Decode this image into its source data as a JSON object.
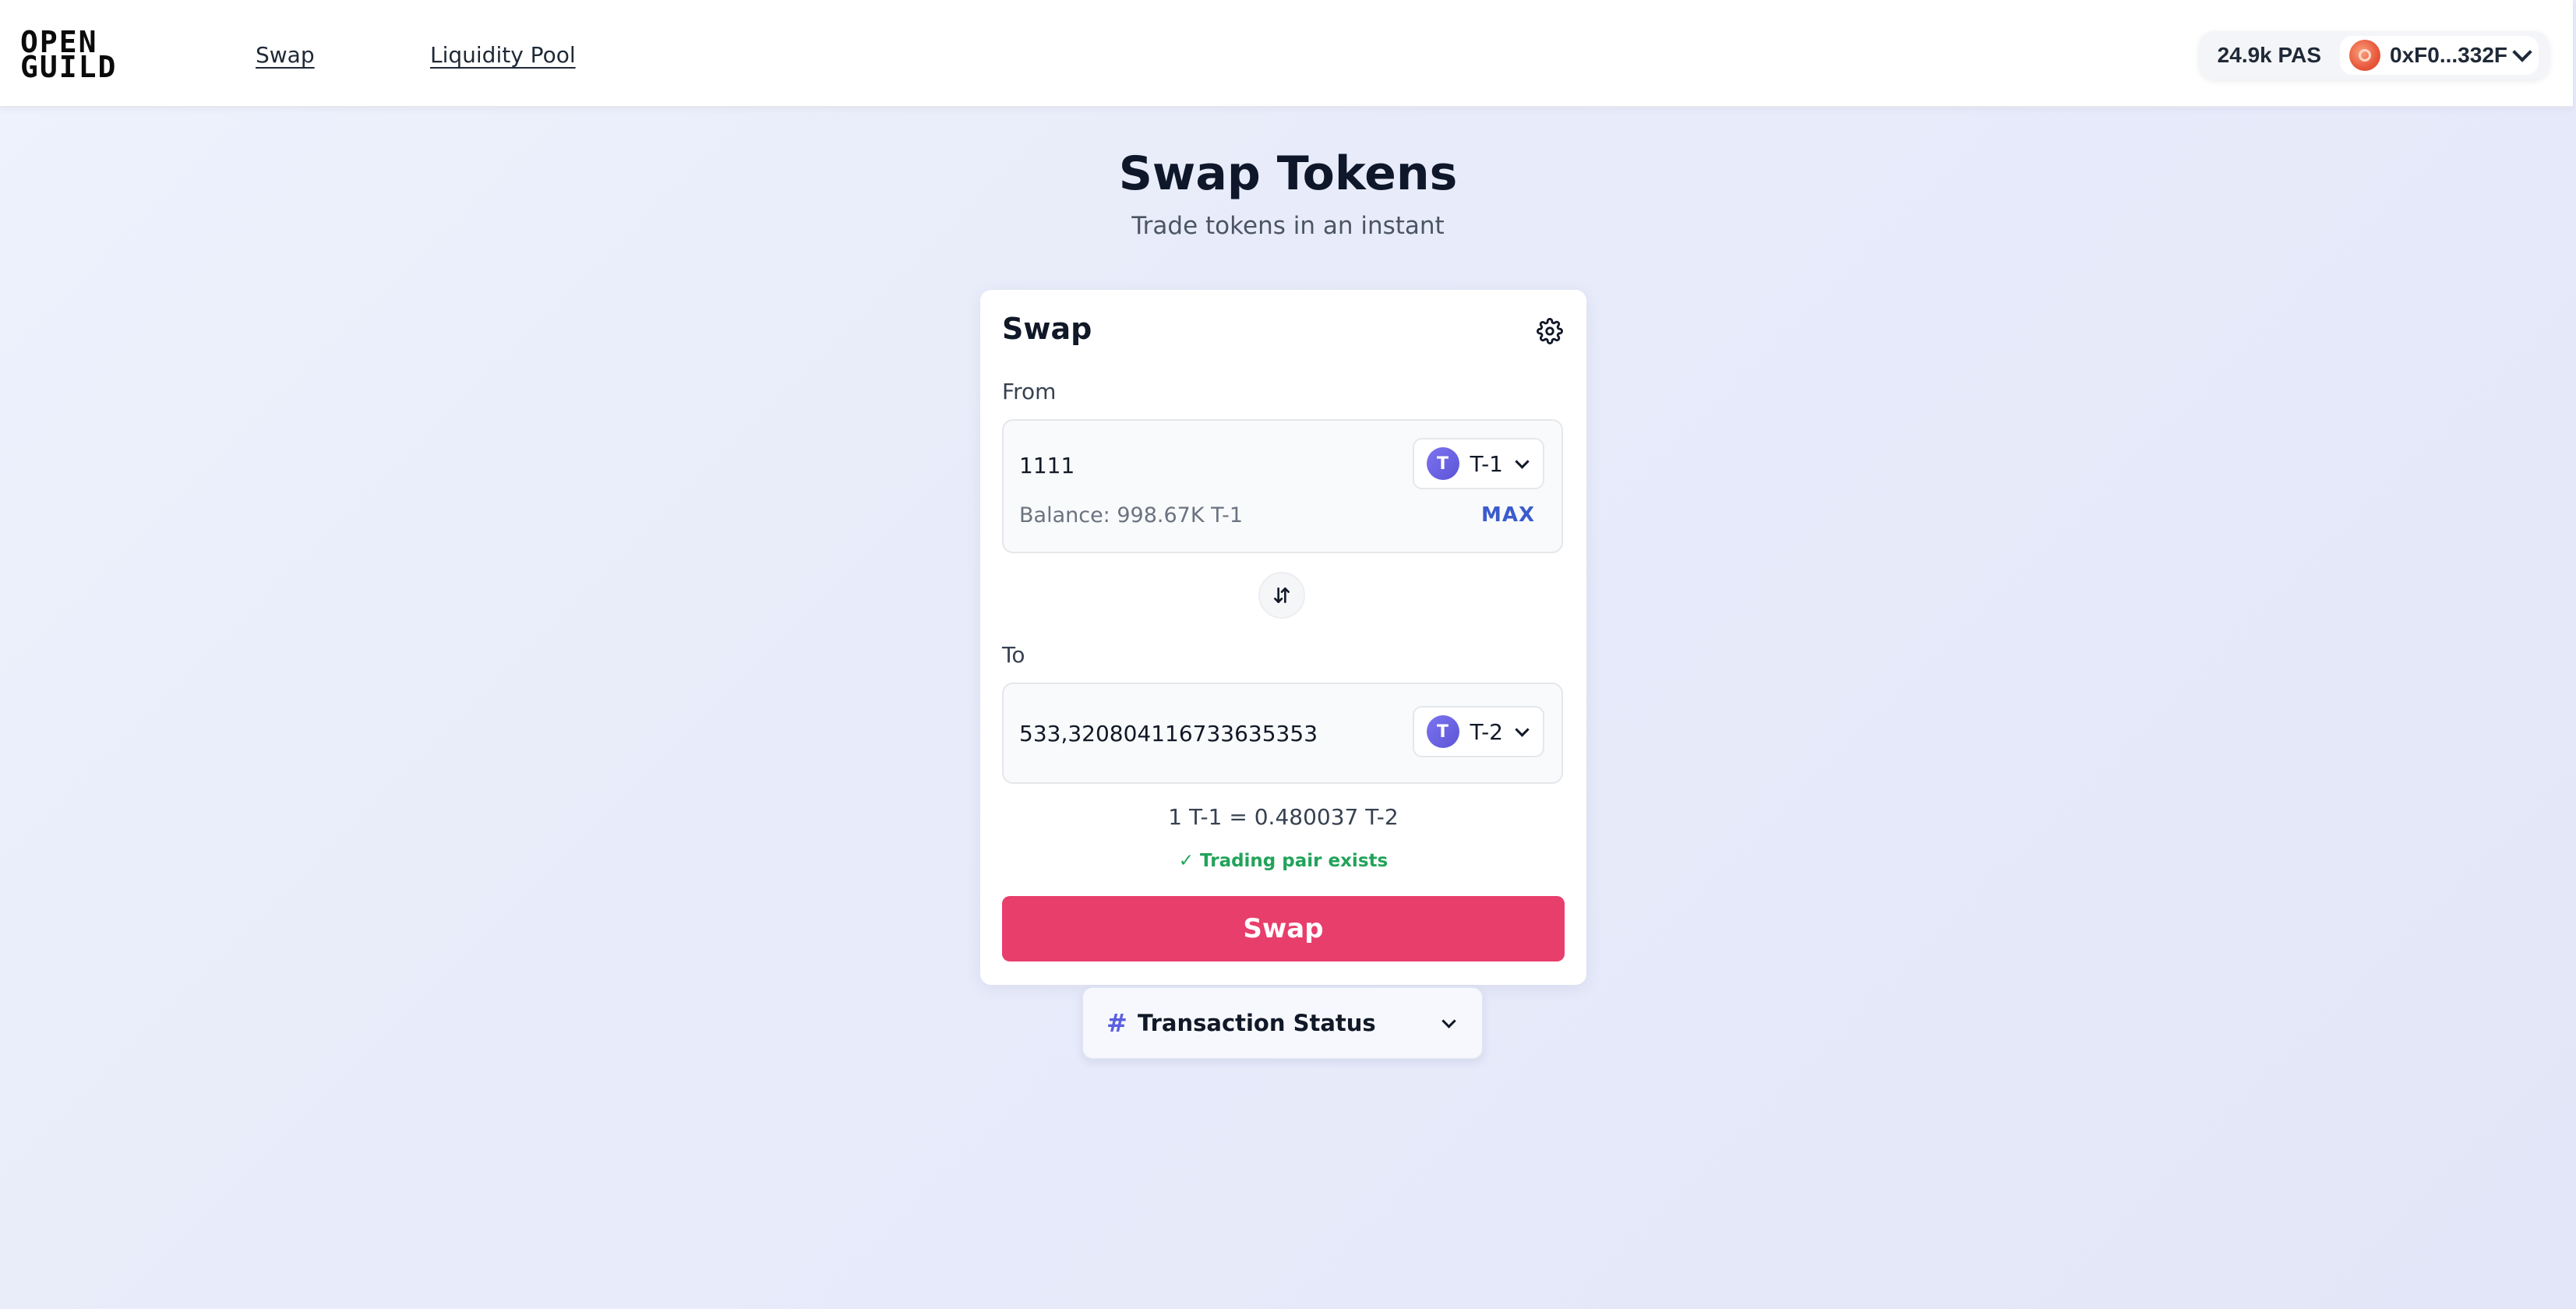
{
  "header": {
    "logo_line1": "OPEN",
    "logo_line2": "GUILD",
    "nav": {
      "swap": "Swap",
      "liquidity_pool": "Liquidity Pool"
    },
    "wallet": {
      "balance": "24.9k PAS",
      "account": "0xF0...332F"
    }
  },
  "page": {
    "title": "Swap Tokens",
    "subtitle": "Trade tokens in an instant"
  },
  "swap_card": {
    "title": "Swap",
    "from": {
      "label": "From",
      "amount": "1111",
      "token_icon_letter": "T",
      "token_symbol": "T-1",
      "balance": "Balance: 998.67K T-1",
      "max_label": "MAX"
    },
    "to": {
      "label": "To",
      "amount": "533,320804116733635353",
      "token_icon_letter": "T",
      "token_symbol": "T-2"
    },
    "rate": "1 T-1 = 0.480037 T-2",
    "pair_status": "✓ Trading pair exists",
    "swap_button": "Swap"
  },
  "transaction_status": {
    "icon_glyph": "#",
    "label": "Transaction Status"
  },
  "colors": {
    "accent_button": "#e83e6c",
    "max_link": "#3b5ccc",
    "success": "#22a35a",
    "token_icon": "#6a63e6"
  }
}
